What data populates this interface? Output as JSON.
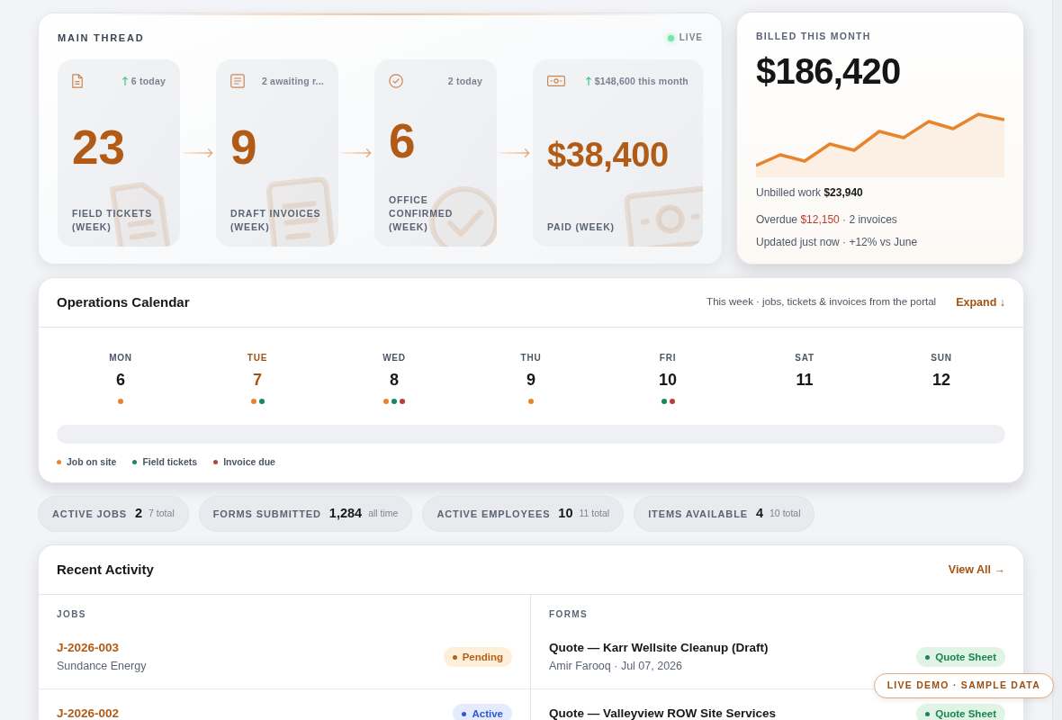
{
  "main_thread": {
    "title": "MAIN THREAD",
    "live_label": "LIVE",
    "stages": [
      {
        "kind": "ticket",
        "hint": "6 today",
        "trend_up": true,
        "value": "23",
        "label": "FIELD TICKETS (WEEK)"
      },
      {
        "kind": "invoice",
        "hint": "2 awaiting r...",
        "trend_up": false,
        "value": "9",
        "label": "DRAFT INVOICES (WEEK)"
      },
      {
        "kind": "confirmed",
        "hint": "2 today",
        "trend_up": false,
        "value": "6",
        "label": "OFFICE CONFIRMED (WEEK)"
      },
      {
        "kind": "payment",
        "hint": "$148,600 this month",
        "trend_up": true,
        "value": "$38,400",
        "label": "PAID (WEEK)"
      }
    ]
  },
  "billed": {
    "title": "BILLED THIS MONTH",
    "amount": "$186,420",
    "unbilled": {
      "label": "Unbilled work",
      "amount": "$23,940"
    },
    "overdue": {
      "label": "Overdue",
      "amount": "$12,150",
      "detail": "· 2 invoices"
    },
    "updated": "Updated just now · +12% vs June"
  },
  "calendar": {
    "title": "Operations Calendar",
    "subtitle": "This week · jobs, tickets & invoices from the portal",
    "expand_label": "Expand ↓",
    "days": [
      {
        "name": "MON",
        "date": "6",
        "selected": false,
        "events": [
          {
            "color": "#e8842c"
          }
        ]
      },
      {
        "name": "TUE",
        "date": "7",
        "selected": true,
        "events": [
          {
            "color": "#e8842c"
          },
          {
            "color": "#168a5a"
          }
        ]
      },
      {
        "name": "WED",
        "date": "8",
        "selected": false,
        "events": [
          {
            "color": "#e8842c"
          },
          {
            "color": "#168a5a"
          },
          {
            "color": "#b8403a"
          }
        ]
      },
      {
        "name": "THU",
        "date": "9",
        "selected": false,
        "events": [
          {
            "color": "#e8842c"
          }
        ]
      },
      {
        "name": "FRI",
        "date": "10",
        "selected": false,
        "events": [
          {
            "color": "#168a5a"
          },
          {
            "color": "#b8403a"
          }
        ]
      },
      {
        "name": "SAT",
        "date": "11",
        "selected": false
      },
      {
        "name": "SUN",
        "date": "12",
        "selected": false
      }
    ],
    "legend": [
      {
        "label": "Job on site",
        "color": "#e8842c"
      },
      {
        "label": "Field tickets",
        "color": "#168a5a"
      },
      {
        "label": "Invoice due",
        "color": "#b8403a"
      }
    ]
  },
  "stats": [
    {
      "label": "ACTIVE JOBS",
      "value": "2",
      "note": "7 total"
    },
    {
      "label": "FORMS SUBMITTED",
      "value": "1,284",
      "note": "all time"
    },
    {
      "label": "ACTIVE EMPLOYEES",
      "value": "10",
      "note": "11 total"
    },
    {
      "label": "ITEMS AVAILABLE",
      "value": "4",
      "note": "10 total"
    }
  ],
  "recent_activity": {
    "title": "Recent Activity",
    "view_all": "View All →",
    "jobs": {
      "heading": "JOBS",
      "rows": [
        {
          "id": "J-2026-003",
          "client": "Sundance Energy",
          "status": {
            "label": "Pending",
            "kind": "pending"
          }
        },
        {
          "id": "J-2026-002",
          "status": {
            "label": "Active",
            "kind": "active"
          }
        }
      ]
    },
    "forms": {
      "heading": "FORMS",
      "rows": [
        {
          "title": "Quote — Karr Wellsite Cleanup (Draft)",
          "meta": "Amir Farooq · Jul 07, 2026",
          "tag": {
            "label": "Quote Sheet",
            "kind": "quote"
          }
        },
        {
          "title": "Quote — Valleyview ROW Site Services",
          "tag": {
            "label": "Quote Sheet",
            "kind": "quote"
          }
        }
      ]
    }
  },
  "demo_badge": "LIVE DEMO · SAMPLE DATA"
}
